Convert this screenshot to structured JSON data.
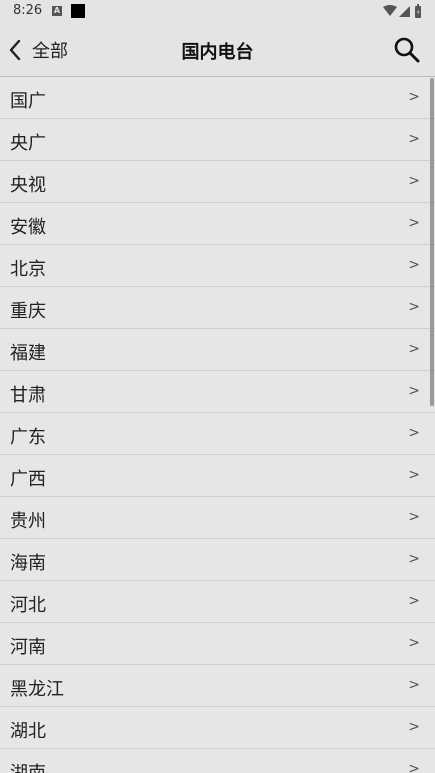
{
  "status": {
    "time": "8:26",
    "app_icon_letter": "A"
  },
  "header": {
    "back_label": "全部",
    "title": "国内电台"
  },
  "list": {
    "arrow": ">",
    "items": [
      {
        "label": "国广"
      },
      {
        "label": "央广"
      },
      {
        "label": "央视"
      },
      {
        "label": "安徽"
      },
      {
        "label": "北京"
      },
      {
        "label": "重庆"
      },
      {
        "label": "福建"
      },
      {
        "label": "甘肃"
      },
      {
        "label": "广东"
      },
      {
        "label": "广西"
      },
      {
        "label": "贵州"
      },
      {
        "label": "海南"
      },
      {
        "label": "河北"
      },
      {
        "label": "河南"
      },
      {
        "label": "黑龙江"
      },
      {
        "label": "湖北"
      },
      {
        "label": "湖南"
      }
    ]
  }
}
